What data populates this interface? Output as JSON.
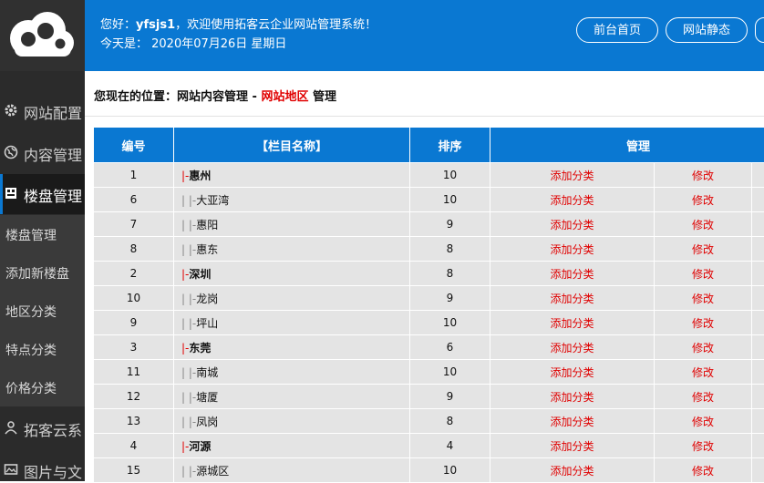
{
  "header": {
    "greeting_prefix": "您好：",
    "username": "yfsjs1",
    "greeting_suffix": "，欢迎使用拓客云企业网站管理系统！",
    "date_text": "今天是： 2020年07月26日 星期日",
    "buttons": [
      "前台首页",
      "网站静态"
    ]
  },
  "sidebar": {
    "items": [
      {
        "label": "网站配置",
        "icon": "gear-icon"
      },
      {
        "label": "内容管理",
        "icon": "globe-icon"
      },
      {
        "label": "楼盘管理",
        "icon": "building-icon",
        "active": true
      },
      {
        "label": "拓客云系",
        "icon": "user-icon"
      },
      {
        "label": "图片与文",
        "icon": "image-icon"
      }
    ],
    "sub_items": [
      "楼盘管理",
      "添加新楼盘",
      "地区分类",
      "特点分类",
      "价格分类"
    ]
  },
  "breadcrumb": {
    "prefix": "您现在的位置：网站内容管理 - ",
    "highlight": "网站地区",
    "suffix": " 管理"
  },
  "table": {
    "headers": [
      "编号",
      "【栏目名称】",
      "排序",
      "管理"
    ],
    "rows": [
      {
        "id": "1",
        "prefix": "|-",
        "name": "惠州",
        "top": true,
        "order": "10",
        "add": "添加分类",
        "edit": "修改"
      },
      {
        "id": "6",
        "prefix": "| |-",
        "name": "大亚湾",
        "top": false,
        "order": "10",
        "add": "添加分类",
        "edit": "修改"
      },
      {
        "id": "7",
        "prefix": "| |-",
        "name": "惠阳",
        "top": false,
        "order": "9",
        "add": "添加分类",
        "edit": "修改"
      },
      {
        "id": "8",
        "prefix": "| |-",
        "name": "惠东",
        "top": false,
        "order": "8",
        "add": "添加分类",
        "edit": "修改"
      },
      {
        "id": "2",
        "prefix": "|-",
        "name": "深圳",
        "top": true,
        "order": "8",
        "add": "添加分类",
        "edit": "修改"
      },
      {
        "id": "10",
        "prefix": "| |-",
        "name": "龙岗",
        "top": false,
        "order": "9",
        "add": "添加分类",
        "edit": "修改"
      },
      {
        "id": "9",
        "prefix": "| |-",
        "name": "坪山",
        "top": false,
        "order": "10",
        "add": "添加分类",
        "edit": "修改"
      },
      {
        "id": "3",
        "prefix": "|-",
        "name": "东莞",
        "top": true,
        "order": "6",
        "add": "添加分类",
        "edit": "修改"
      },
      {
        "id": "11",
        "prefix": "| |-",
        "name": "南城",
        "top": false,
        "order": "10",
        "add": "添加分类",
        "edit": "修改"
      },
      {
        "id": "12",
        "prefix": "| |-",
        "name": "塘厦",
        "top": false,
        "order": "9",
        "add": "添加分类",
        "edit": "修改"
      },
      {
        "id": "13",
        "prefix": "| |-",
        "name": "凤岗",
        "top": false,
        "order": "8",
        "add": "添加分类",
        "edit": "修改"
      },
      {
        "id": "4",
        "prefix": "|-",
        "name": "河源",
        "top": true,
        "order": "4",
        "add": "添加分类",
        "edit": "修改"
      },
      {
        "id": "15",
        "prefix": "| |-",
        "name": "源城区",
        "top": false,
        "order": "10",
        "add": "添加分类",
        "edit": "修改"
      }
    ]
  },
  "colors": {
    "brand": "#0a78d2",
    "link_red": "#e00000",
    "sidebar_bg": "#2b2b2b"
  }
}
